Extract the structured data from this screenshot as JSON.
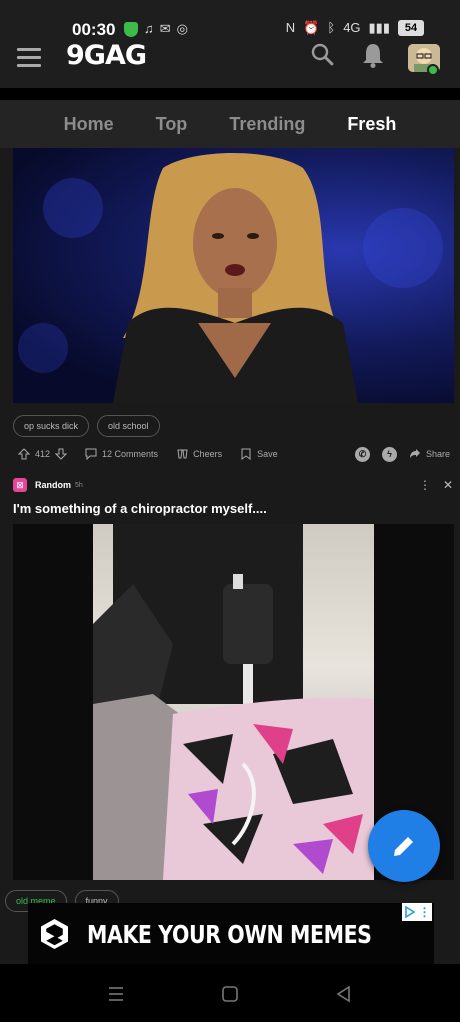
{
  "status_bar": {
    "time": "00:30",
    "network": "4G",
    "battery": "54"
  },
  "header": {
    "logo": "9GAG",
    "icons": [
      "menu-icon",
      "search-icon",
      "bell-icon",
      "avatar"
    ]
  },
  "tabs": [
    {
      "label": "Home",
      "active": false
    },
    {
      "label": "Top",
      "active": false
    },
    {
      "label": "Trending",
      "active": false
    },
    {
      "label": "Fresh",
      "active": true
    }
  ],
  "post1": {
    "tags": [
      "op sucks dick",
      "old school"
    ],
    "upvotes": "412",
    "comments": "12 Comments",
    "cheers": "Cheers",
    "save": "Save",
    "share": "Share"
  },
  "post2": {
    "section": "Random",
    "time": "5h",
    "title": "I'm something of a chiropractor myself....",
    "tags": [
      "old meme",
      "funny"
    ]
  },
  "ad": {
    "text": "MAKE YOUR OWN MEMES"
  },
  "colors": {
    "accent": "#1f7fe6",
    "green": "#3cbb4a",
    "section_pink": "#e3469b",
    "background": "#1a1a1a"
  }
}
